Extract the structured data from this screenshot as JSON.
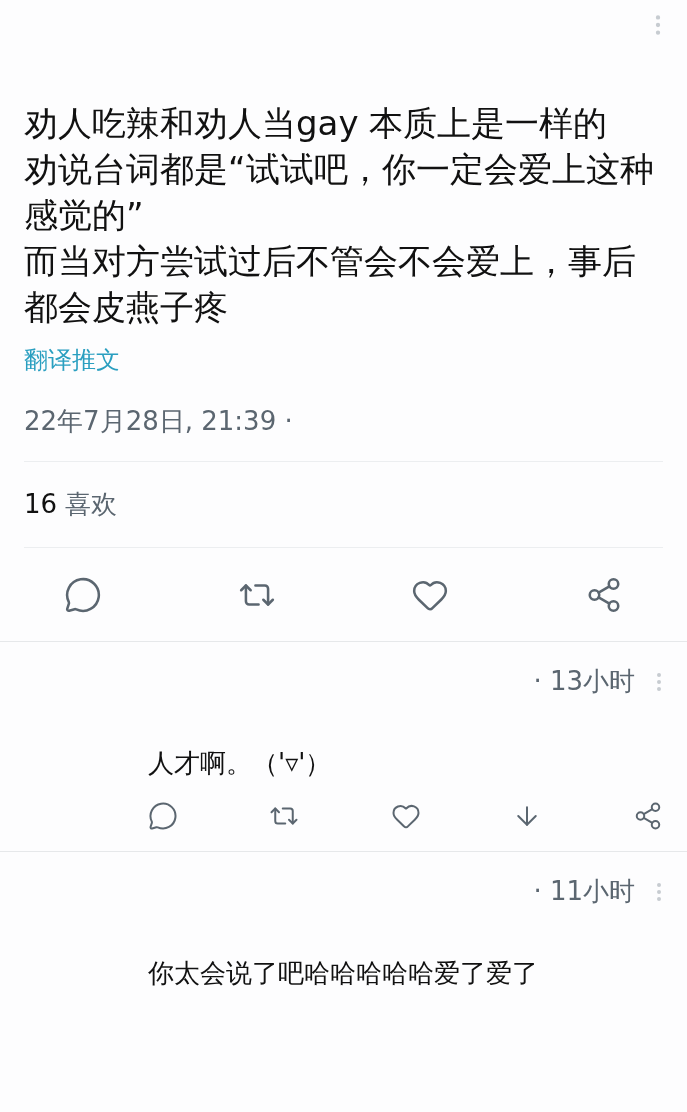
{
  "tweet": {
    "paragraphs": [
      "劝人吃辣和劝人当gay 本质上是一样的",
      "劝说台词都是“试试吧，你一定会爱上这种感觉的”",
      "而当对方尝试过后不管会不会爱上，事后都会皮燕子疼"
    ],
    "translate_link": "翻译推文",
    "timestamp": "22年7月28日, 21:39 ·",
    "likes": {
      "count": "16",
      "label": "喜欢"
    },
    "actions": [
      {
        "kind": "reply"
      },
      {
        "kind": "retweet"
      },
      {
        "kind": "like"
      },
      {
        "kind": "share"
      }
    ]
  },
  "replies": [
    {
      "time": "· 13小时",
      "text": "人才啊。（'▿'）",
      "actions": [
        {
          "kind": "reply"
        },
        {
          "kind": "retweet"
        },
        {
          "kind": "like"
        },
        {
          "kind": "download"
        },
        {
          "kind": "share"
        }
      ]
    },
    {
      "time": "· 11小时",
      "text": "你太会说了吧哈哈哈哈哈爱了爱了"
    }
  ]
}
